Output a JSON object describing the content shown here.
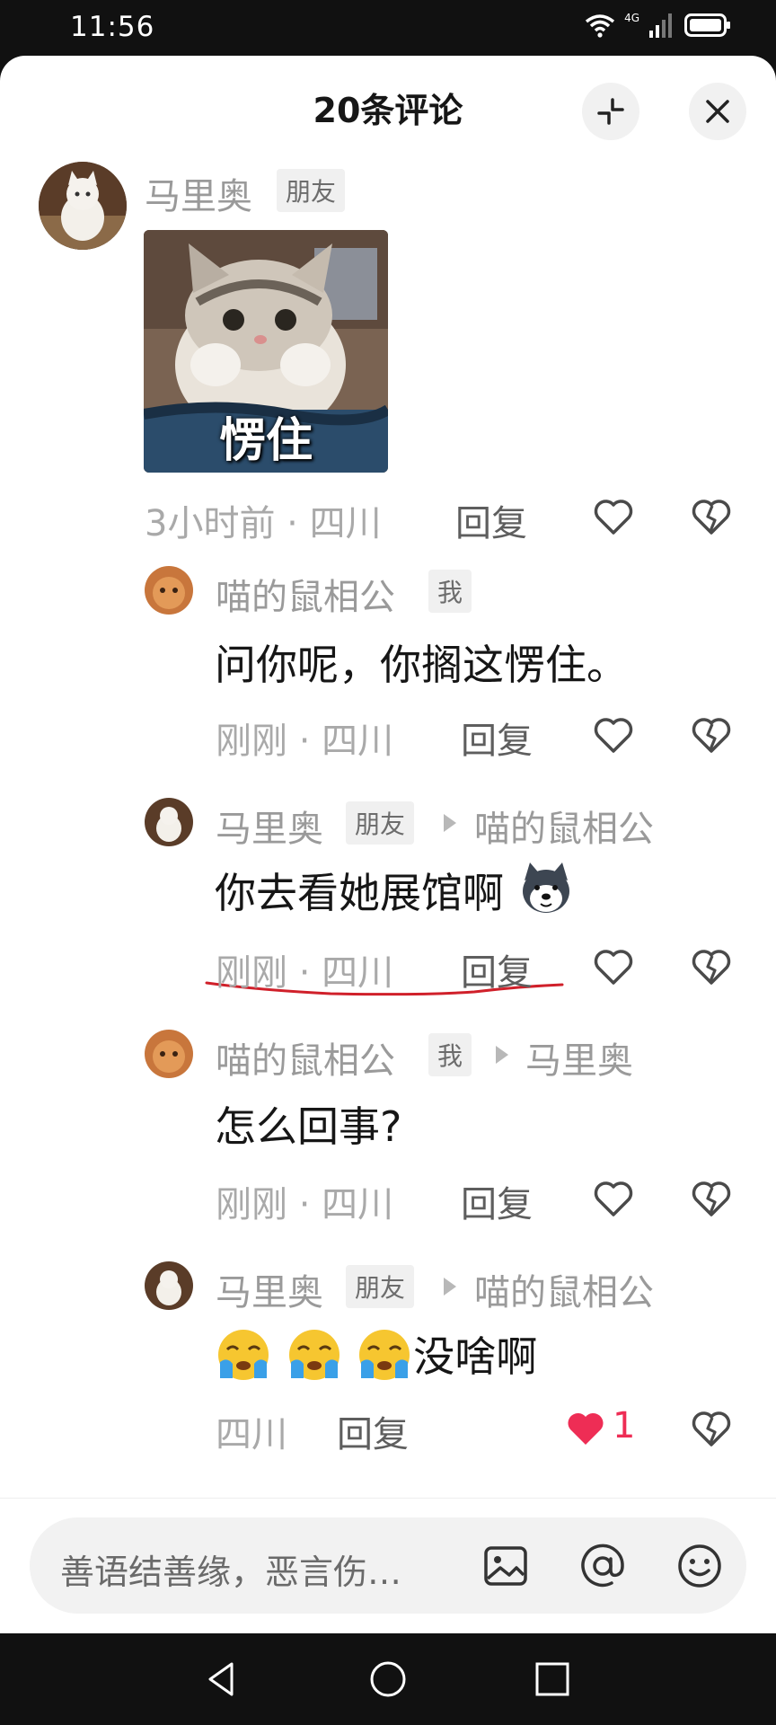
{
  "status_bar": {
    "time": "11:56",
    "network": "4G"
  },
  "header": {
    "title": "20条评论"
  },
  "comments": [
    {
      "author": "马里奥",
      "tag": "朋友",
      "image_caption": "愣住",
      "time": "3小时前",
      "location": "四川",
      "reply_label": "回复"
    },
    {
      "author": "喵的鼠相公",
      "tag": "我",
      "text": "问你呢，你搁这愣住。",
      "time": "刚刚",
      "location": "四川",
      "reply_label": "回复"
    },
    {
      "author": "马里奥",
      "tag": "朋友",
      "reply_to": "喵的鼠相公",
      "text": "你去看她展馆啊",
      "time": "刚刚",
      "location": "四川",
      "reply_label": "回复"
    },
    {
      "author": "喵的鼠相公",
      "tag": "我",
      "reply_to": "马里奥",
      "text": "怎么回事?",
      "time": "刚刚",
      "location": "四川",
      "reply_label": "回复"
    },
    {
      "author": "马里奥",
      "tag": "朋友",
      "reply_to": "喵的鼠相公",
      "text": "没啥啊",
      "location": "四川",
      "reply_label": "回复",
      "likes": "1"
    }
  ],
  "input": {
    "placeholder": "善语结善缘，恶言伤…"
  },
  "colors": {
    "like_active": "#ee2d55",
    "underline": "#d0202a"
  }
}
